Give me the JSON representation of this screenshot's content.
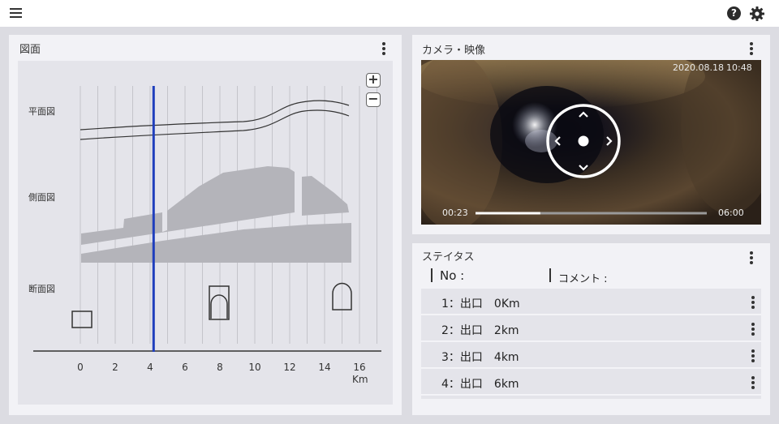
{
  "icons": {
    "menu": "hamburger-menu-icon",
    "help": "question-circle-icon",
    "settings": "gear-icon",
    "more": "kebab-more-icon"
  },
  "header": {
    "help_glyph": "?"
  },
  "drawing_panel": {
    "title": "図面",
    "row_labels": {
      "plan": "平面図",
      "profile": "側面図",
      "section": "断面図"
    },
    "zoom_in": "+",
    "zoom_out": "−",
    "x_ticks": [
      "0",
      "2",
      "4",
      "6",
      "8",
      "10",
      "12",
      "14",
      "16"
    ],
    "x_unit": "Km",
    "cursor_km": 4.2,
    "colors": {
      "cursor": "#1f3ebd",
      "profile_fill": "#b4b4ba"
    }
  },
  "camera_panel": {
    "title": "カメラ・映像",
    "timestamp_date": "2020.08.18",
    "timestamp_time": "10:48",
    "current_time": "00:23",
    "duration": "06:00",
    "progress": 0.28
  },
  "status_panel": {
    "title": "ステイタス",
    "col_no": "No :",
    "col_comment": "コメント :",
    "rows": [
      {
        "label": "1：出口　0Km"
      },
      {
        "label": "2：出口　2km"
      },
      {
        "label": "3：出口　4km"
      },
      {
        "label": "4：出口　6km"
      }
    ]
  }
}
